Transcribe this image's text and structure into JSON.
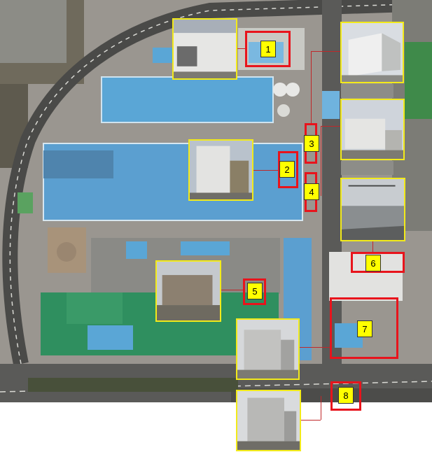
{
  "markers": [
    {
      "id": "marker-1",
      "label": "1"
    },
    {
      "id": "marker-2",
      "label": "2"
    },
    {
      "id": "marker-3",
      "label": "3"
    },
    {
      "id": "marker-4",
      "label": "4"
    },
    {
      "id": "marker-5",
      "label": "5"
    },
    {
      "id": "marker-6",
      "label": "6"
    },
    {
      "id": "marker-7",
      "label": "7"
    },
    {
      "id": "marker-8",
      "label": "8"
    }
  ],
  "colors": {
    "highlight_box": "#e8141c",
    "photo_border": "#f2ea1a",
    "label_fill": "#ffff00",
    "roof_blue": "#5aa6d6",
    "roof_green": "#2f8f5f"
  },
  "icons": [
    "site-photo-thumbnail",
    "aerial-site-map"
  ]
}
